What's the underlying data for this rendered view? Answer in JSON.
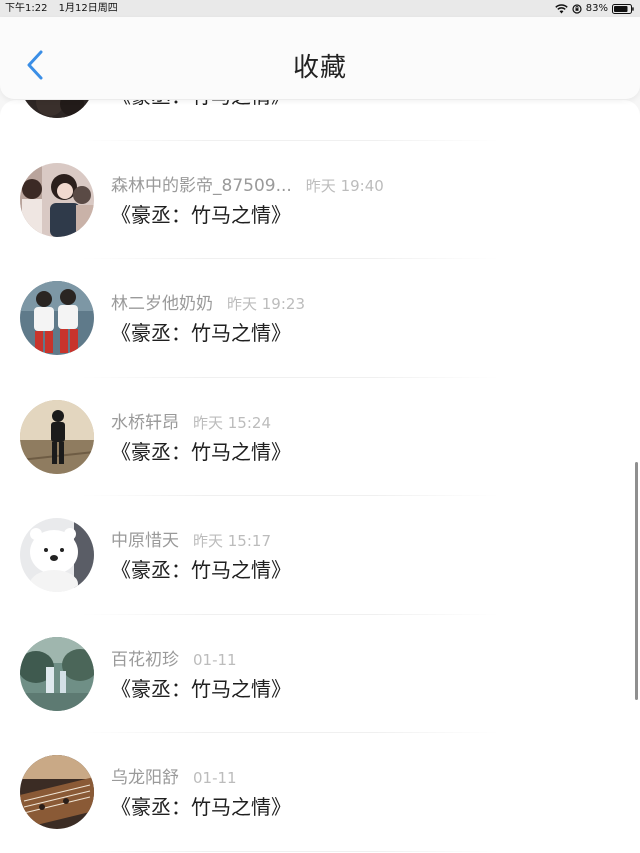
{
  "status_bar": {
    "time": "下午1:22",
    "date": "1月12日周四",
    "battery": "83%",
    "icons": [
      "wifi-icon",
      "orientation-lock-icon",
      "battery-icon"
    ]
  },
  "nav": {
    "title": "收藏",
    "back_icon": "chevron-left-icon",
    "accent_color": "#3a8ee6"
  },
  "favorites": [
    {
      "name": "",
      "time": "",
      "message": "《豪丞：竹马之情》",
      "avatar": "avatar-dark"
    },
    {
      "name": "森林中的影帝_87509...",
      "time": "昨天 19:40",
      "message": "《豪丞：竹马之情》",
      "avatar": "avatar-couple"
    },
    {
      "name": "林二岁他奶奶",
      "time": "昨天 19:23",
      "message": "《豪丞：竹马之情》",
      "avatar": "avatar-pair-red"
    },
    {
      "name": "水桥轩昂",
      "time": "昨天 15:24",
      "message": "《豪丞：竹马之情》",
      "avatar": "avatar-walker"
    },
    {
      "name": "中原惜天",
      "time": "昨天 15:17",
      "message": "《豪丞：竹马之情》",
      "avatar": "avatar-polar-bear"
    },
    {
      "name": "百花初珍",
      "time": "01-11",
      "message": "《豪丞：竹马之情》",
      "avatar": "avatar-waterfall"
    },
    {
      "name": "乌龙阳舒",
      "time": "01-11",
      "message": "《豪丞：竹马之情》",
      "avatar": "avatar-guzheng"
    }
  ]
}
